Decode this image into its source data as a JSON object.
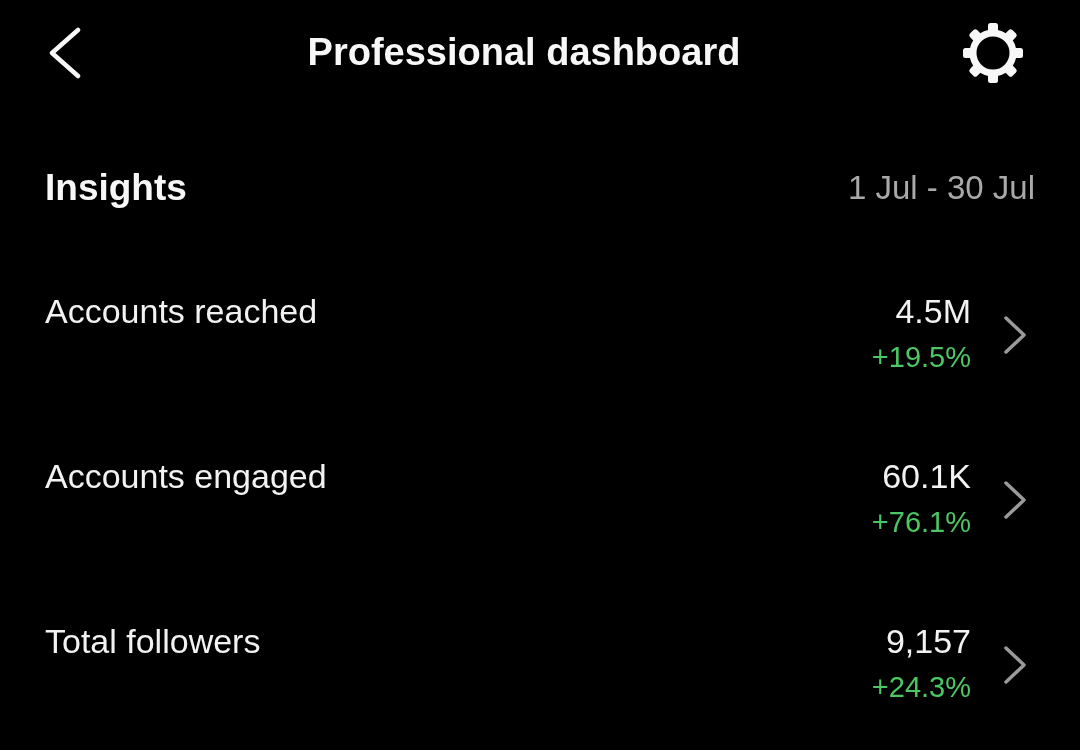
{
  "header": {
    "title": "Professional dashboard"
  },
  "insights": {
    "title": "Insights",
    "date_range": "1 Jul - 30 Jul"
  },
  "metrics": [
    {
      "label": "Accounts reached",
      "value": "4.5M",
      "change": "+19.5%"
    },
    {
      "label": "Accounts engaged",
      "value": "60.1K",
      "change": "+76.1%"
    },
    {
      "label": "Total followers",
      "value": "9,157",
      "change": "+24.3%"
    }
  ]
}
